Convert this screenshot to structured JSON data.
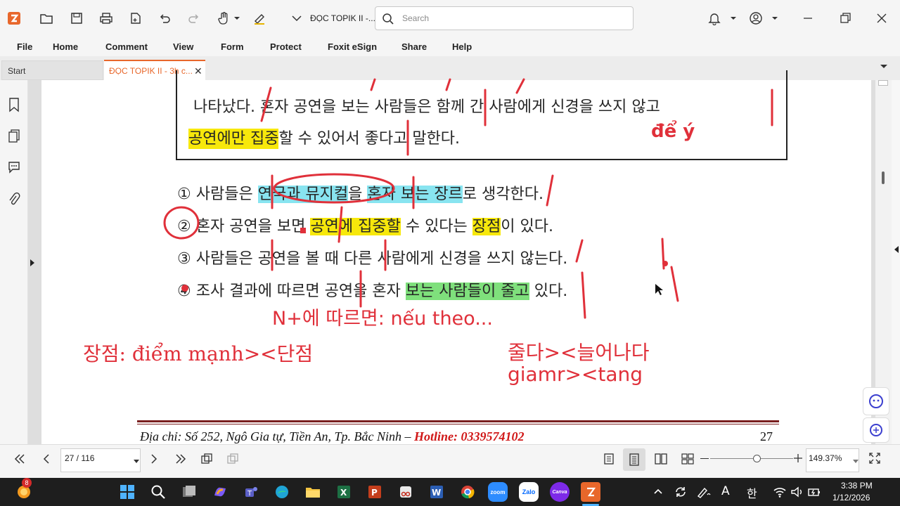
{
  "app": {
    "doc_title": "ĐỌC TOPIK II -...",
    "search_placeholder": "Search"
  },
  "menu": [
    "File",
    "Home",
    "Comment",
    "View",
    "Form",
    "Protect",
    "Foxit eSign",
    "Share",
    "Help"
  ],
  "tabs": {
    "start": "Start",
    "doc": "ĐỌC TOPIK II - 3h c...",
    "close": "✕"
  },
  "page": {
    "passage_line1": "나타났다. 혼자 공연을 보는 사람들은 함께 간 사람에게 신경을 쓰지 않고",
    "passage_line2_hl": "공연에만 집중",
    "passage_line2_rest": "할 수 있어서 좋다고 말한다.",
    "note_de_y": "để ý",
    "opt1": {
      "num": "①",
      "a": "사람들은 ",
      "b": "연극과 뮤지컬",
      "c": "을 ",
      "d": "혼자 보는 장르",
      "e": "로 생각한다."
    },
    "opt2": {
      "num": "②",
      "a": "혼자 공연을 보면 ",
      "b": "공연에 집중할",
      "c": " 수 있다는 ",
      "d": "장점",
      "e": "이 있다."
    },
    "opt3": {
      "num": "③",
      "text": "사람들은 공연을 볼 때 다른 사람에게 신경을 쓰지 않는다."
    },
    "opt4": {
      "num": "④",
      "a": "조사 결과에 따르면 공연을 혼자 ",
      "b": "보는 사람들이 줄고",
      "c": " 있다."
    },
    "note_theo": "N+에 따르면: nếu theo...",
    "note_jangjeom": "장점: điểm mạnh><단점",
    "note_julda": "줄다><늘어나다",
    "note_giam": "giamr><tang",
    "footer_addr": "Địa chỉ: Số 252, Ngô Gia tự, Tiền An, Tp. Bắc Ninh – ",
    "footer_hotline": "Hotline: 0339574102",
    "footer_page": "27"
  },
  "status": {
    "page_value": "27 / 116",
    "zoom_value": "149.37%"
  },
  "taskbar": {
    "badge": "8",
    "ime": "A",
    "ime_kr": "한",
    "time": "3:38 PM",
    "date": "1/12/2026"
  },
  "colors": {
    "accent": "#e8672b",
    "annotation_red": "#e0303a",
    "highlight_yellow": "#f7e80b",
    "highlight_cyan": "#88e4f0",
    "highlight_green": "#7fe07c"
  }
}
